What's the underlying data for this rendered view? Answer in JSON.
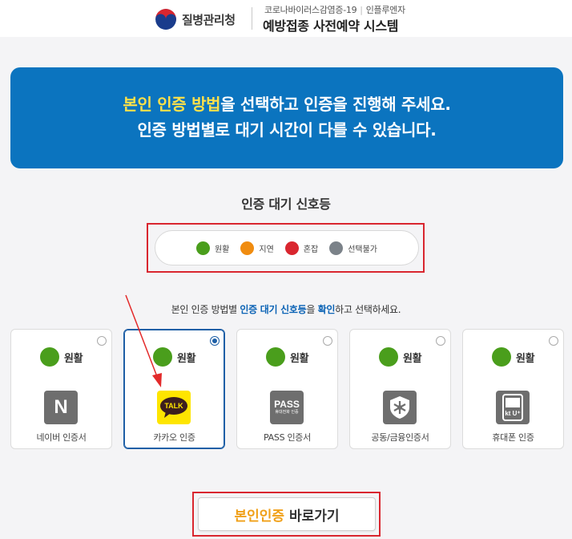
{
  "header": {
    "agency": "질병관리청",
    "subtitle_left": "코로나바이러스감염증-19",
    "subtitle_right": "인플루엔자",
    "title": "예방접종 사전예약 시스템"
  },
  "banner": {
    "line1_highlight": "본인 인증 방법",
    "line1_rest": "을 선택하고 인증을 진행해 주세요.",
    "line2": "인증 방법별로 대기 시간이 다를 수 있습니다."
  },
  "signal": {
    "title": "인증 대기 신호등",
    "legend": [
      {
        "label": "원활",
        "color": "#4a9e1c"
      },
      {
        "label": "지연",
        "color": "#f08c10"
      },
      {
        "label": "혼잡",
        "color": "#d9262f"
      },
      {
        "label": "선택불가",
        "color": "#7b8289"
      }
    ]
  },
  "instruction": {
    "pre": "본인 인증 방법별 ",
    "highlight1": "인증 대기 신호등",
    "mid": "을 ",
    "highlight2": "확인",
    "post": "하고 선택하세요."
  },
  "methods": [
    {
      "status": "원활",
      "label": "네이버 인증서",
      "icon": "naver-icon",
      "selected": false
    },
    {
      "status": "원활",
      "label": "카카오 인증",
      "icon": "kakao-talk-icon",
      "selected": true
    },
    {
      "status": "원활",
      "label": "PASS 인증서",
      "icon": "pass-icon",
      "selected": false
    },
    {
      "status": "원활",
      "label": "공동/금융인증서",
      "icon": "certificate-icon",
      "selected": false
    },
    {
      "status": "원활",
      "label": "휴대폰 인증",
      "icon": "phone-icon",
      "selected": false
    }
  ],
  "icon_text": {
    "naver": "N",
    "kakao": "TALK",
    "pass": "PASS",
    "pass_sub": "휴대전화 인증",
    "phone": "kt U⁺"
  },
  "button": {
    "highlight": "본인인증",
    "rest": "바로가기"
  },
  "colors": {
    "banner": "#0b74bf",
    "highlight_yellow": "#ffe14a",
    "annotation_red": "#d9262f",
    "kakao_yellow": "#fee500"
  }
}
